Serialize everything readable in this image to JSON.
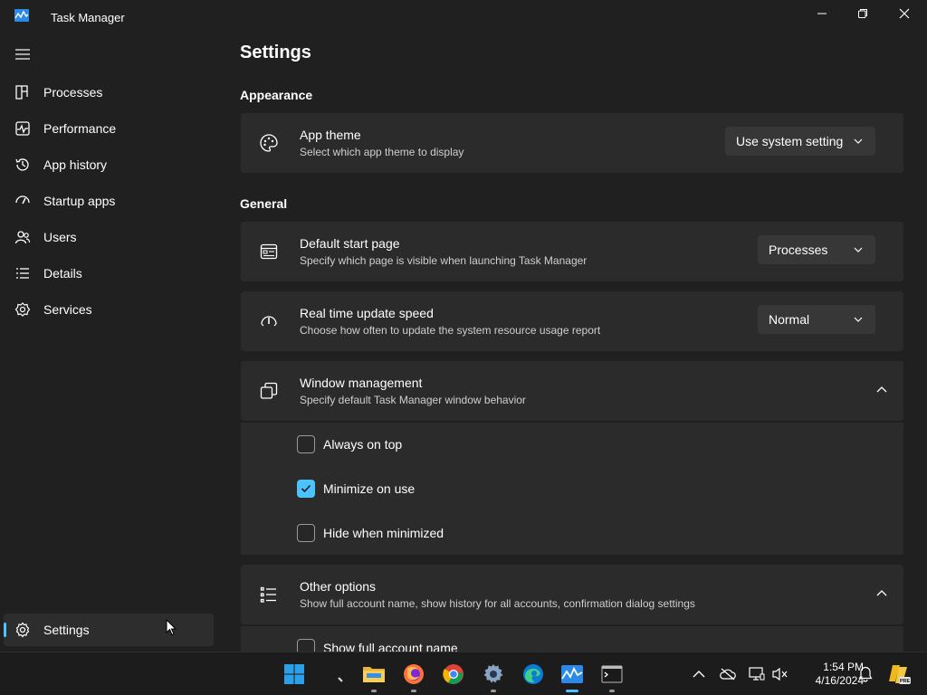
{
  "window": {
    "title": "Task Manager"
  },
  "sidebar": {
    "items": [
      {
        "label": "Processes",
        "icon": "processes-icon"
      },
      {
        "label": "Performance",
        "icon": "performance-icon"
      },
      {
        "label": "App history",
        "icon": "app-history-icon"
      },
      {
        "label": "Startup apps",
        "icon": "startup-apps-icon"
      },
      {
        "label": "Users",
        "icon": "users-icon"
      },
      {
        "label": "Details",
        "icon": "details-icon"
      },
      {
        "label": "Services",
        "icon": "services-icon"
      }
    ],
    "settings_label": "Settings"
  },
  "settings": {
    "title": "Settings",
    "appearance_heading": "Appearance",
    "general_heading": "General",
    "app_theme": {
      "title": "App theme",
      "subtitle": "Select which app theme to display",
      "value": "Use system setting"
    },
    "default_start_page": {
      "title": "Default start page",
      "subtitle": "Specify which page is visible when launching Task Manager",
      "value": "Processes"
    },
    "update_speed": {
      "title": "Real time update speed",
      "subtitle": "Choose how often to update the system resource usage report",
      "value": "Normal"
    },
    "window_management": {
      "title": "Window management",
      "subtitle": "Specify default Task Manager window behavior",
      "options": [
        {
          "label": "Always on top",
          "checked": false
        },
        {
          "label": "Minimize on use",
          "checked": true
        },
        {
          "label": "Hide when minimized",
          "checked": false
        }
      ]
    },
    "other_options": {
      "title": "Other options",
      "subtitle": "Show full account name, show history for all accounts, confirmation dialog settings",
      "options": [
        {
          "label": "Show full account name",
          "checked": false
        }
      ]
    }
  },
  "taskbar": {
    "time": "1:54 PM",
    "date": "4/16/2024",
    "badge": "PRE"
  },
  "colors": {
    "accent": "#4cc2ff",
    "background": "#202020",
    "card": "#2b2b2b"
  }
}
